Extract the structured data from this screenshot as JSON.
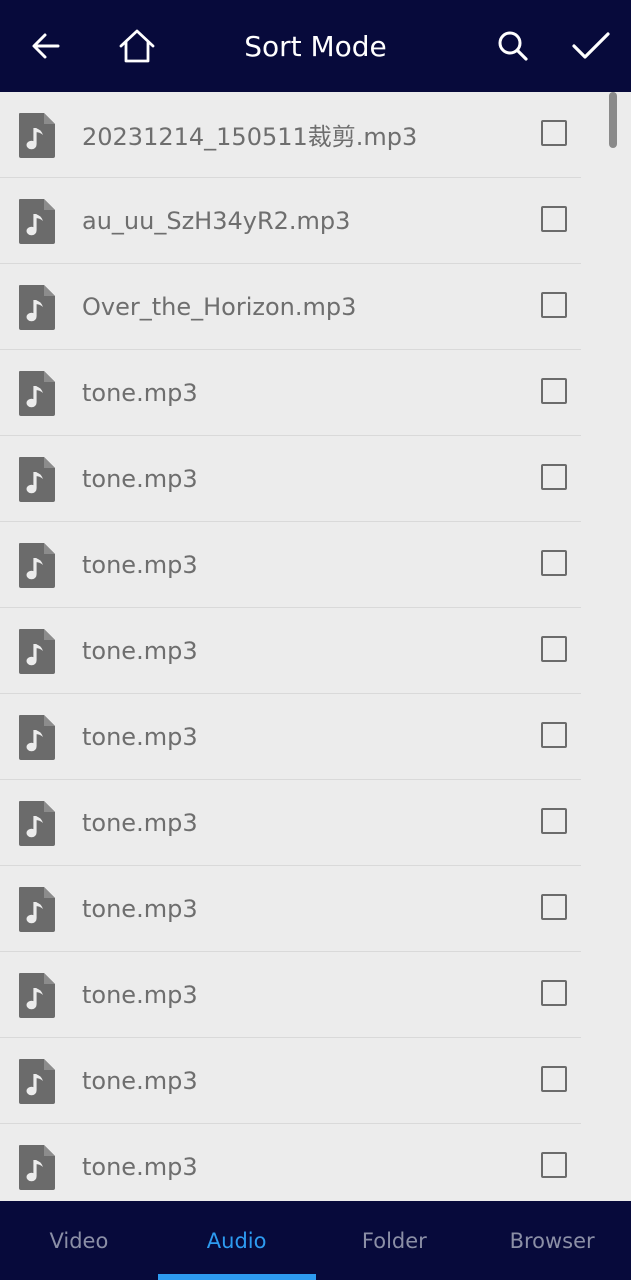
{
  "header": {
    "title": "Sort Mode",
    "back_icon": "arrow-left-icon",
    "home_icon": "home-icon",
    "search_icon": "search-icon",
    "confirm_icon": "check-icon"
  },
  "files": [
    {
      "name": "20231214_150511裁剪.mp3",
      "checked": false
    },
    {
      "name": "au_uu_SzH34yR2.mp3",
      "checked": false
    },
    {
      "name": "Over_the_Horizon.mp3",
      "checked": false
    },
    {
      "name": "tone.mp3",
      "checked": false
    },
    {
      "name": "tone.mp3",
      "checked": false
    },
    {
      "name": "tone.mp3",
      "checked": false
    },
    {
      "name": "tone.mp3",
      "checked": false
    },
    {
      "name": "tone.mp3",
      "checked": false
    },
    {
      "name": "tone.mp3",
      "checked": false
    },
    {
      "name": "tone.mp3",
      "checked": false
    },
    {
      "name": "tone.mp3",
      "checked": false
    },
    {
      "name": "tone.mp3",
      "checked": false
    },
    {
      "name": "tone.mp3",
      "checked": false
    }
  ],
  "file_icon": "audio-file-icon",
  "tabs": [
    {
      "label": "Video",
      "active": false
    },
    {
      "label": "Audio",
      "active": true
    },
    {
      "label": "Folder",
      "active": false
    },
    {
      "label": "Browser",
      "active": false
    }
  ],
  "colors": {
    "bar_background": "#070a3b",
    "accent": "#2d9bf0",
    "list_background": "#ececec",
    "text": "#6e6e6e"
  }
}
